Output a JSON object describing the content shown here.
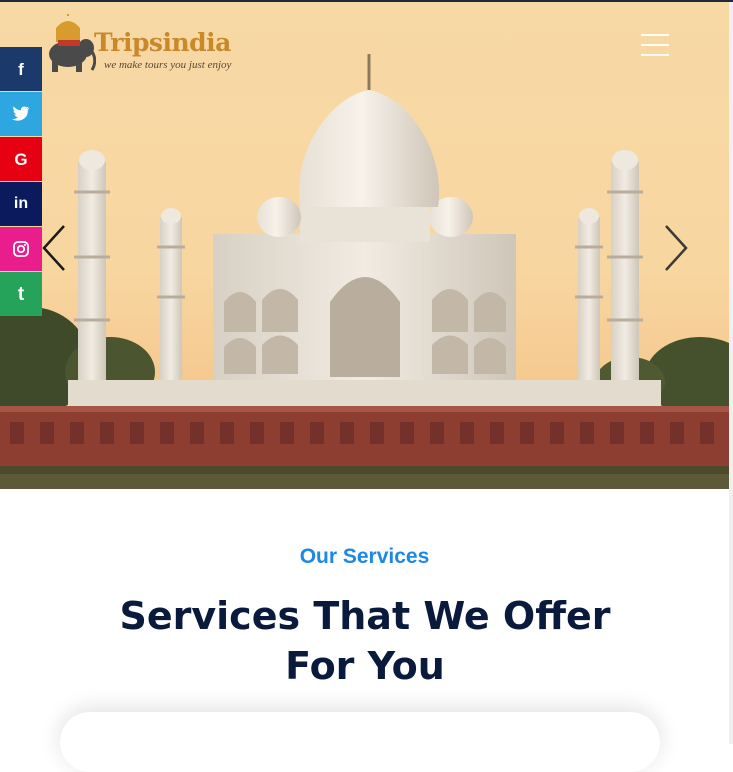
{
  "brand": {
    "name": "Tripsindia",
    "tagline": "we make tours you just enjoy"
  },
  "hero": {
    "image_subject": "Taj Mahal at sunset",
    "prev_icon": "chevron-left-icon",
    "next_icon": "chevron-right-icon",
    "menu_icon": "hamburger-menu-icon"
  },
  "social": [
    {
      "name": "facebook",
      "glyph": "f",
      "color": "#1b3a6b"
    },
    {
      "name": "twitter",
      "glyph": "🐦",
      "color": "#2ea7e0"
    },
    {
      "name": "google",
      "glyph": "G",
      "color": "#e60012"
    },
    {
      "name": "linkedin",
      "glyph": "in",
      "color": "#0a1a5c"
    },
    {
      "name": "instagram",
      "glyph": "◎",
      "color": "#e91e8c"
    },
    {
      "name": "tumblr",
      "glyph": "t",
      "color": "#25a35a"
    }
  ],
  "services": {
    "eyebrow": "Our Services",
    "headline": "Services That We Offer For You"
  },
  "colors": {
    "accent_blue": "#1e88e5",
    "heading_navy": "#0a1a3c",
    "logo_gold": "#c9892b"
  }
}
